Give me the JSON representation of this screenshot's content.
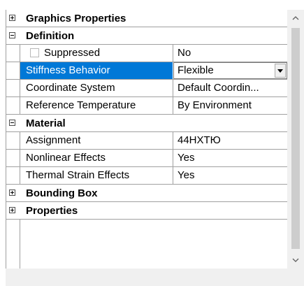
{
  "categories": {
    "graphics": {
      "label": "Graphics Properties",
      "expanded": false
    },
    "definition": {
      "label": "Definition",
      "expanded": true
    },
    "material": {
      "label": "Material",
      "expanded": true
    },
    "bounding": {
      "label": "Bounding Box",
      "expanded": false
    },
    "properties": {
      "label": "Properties",
      "expanded": false
    }
  },
  "definition": {
    "suppressed": {
      "name": "Suppressed",
      "value": "No",
      "checked": false
    },
    "stiffness": {
      "name": "Stiffness Behavior",
      "value": "Flexible"
    },
    "coordinate": {
      "name": "Coordinate System",
      "value": "Default Coordin..."
    },
    "reference": {
      "name": "Reference Temperature",
      "value": "By Environment"
    }
  },
  "material": {
    "assignment": {
      "name": "Assignment",
      "value": "44НХТЮ"
    },
    "nonlinear": {
      "name": "Nonlinear Effects",
      "value": "Yes"
    },
    "thermal": {
      "name": "Thermal Strain Effects",
      "value": "Yes"
    }
  },
  "icons": {
    "expand": "plus-box-icon",
    "collapse": "minus-box-icon",
    "scroll_up": "chevron-up-icon",
    "scroll_down": "chevron-down-icon",
    "dropdown": "dropdown-arrow-icon"
  },
  "colors": {
    "selection": "#0078d7",
    "grid_line": "#a0a0a0",
    "scrollbar_track": "#f0f0f0",
    "scrollbar_thumb": "#cdcdcd"
  }
}
